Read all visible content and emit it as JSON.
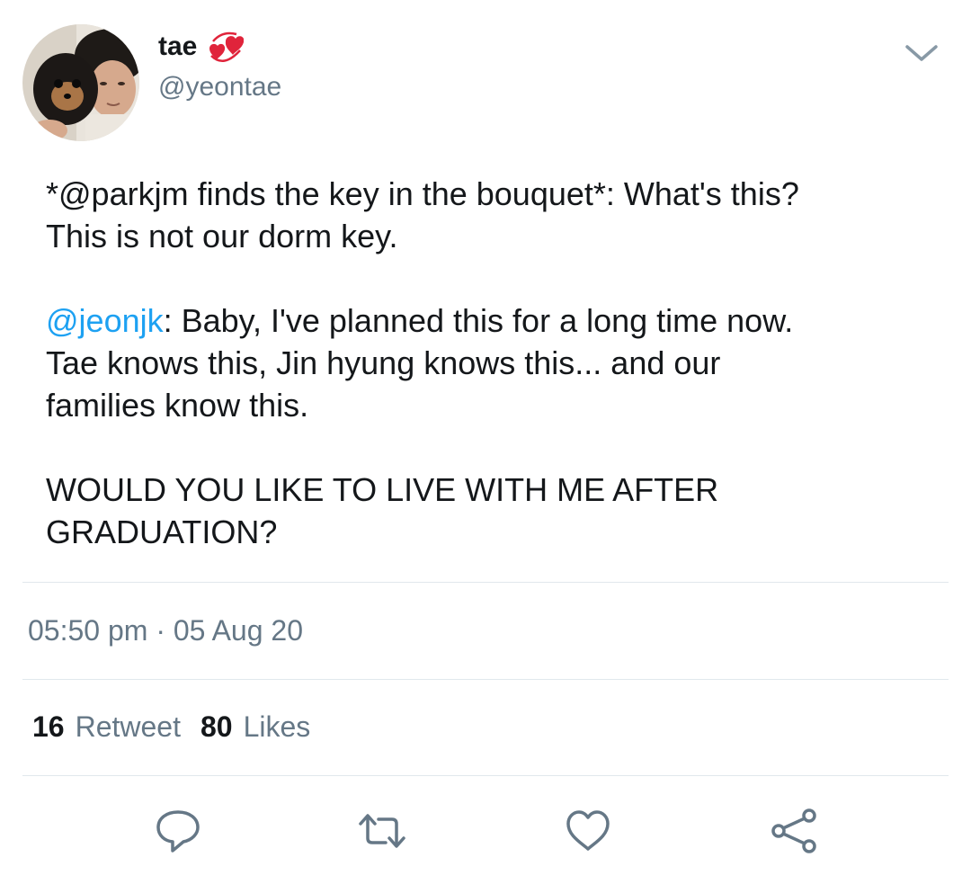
{
  "tweet": {
    "display_name": "tae",
    "name_emoji": "revolving-hearts",
    "handle": "@yeontae",
    "text": {
      "line1_prefix": "*@parkjm finds the key in the bouquet*: What's this?",
      "line2": "This is not our dorm key.",
      "mention2": "@jeonjk",
      "mention2_rest": ": Baby, I've planned this for a long time now.",
      "line4": "Tae knows this, Jin hyung knows this... and our",
      "line5": "families know this.",
      "line6": "WOULD YOU LIKE TO LIVE WITH ME AFTER",
      "line7": "GRADUATION?"
    },
    "timestamp": "05:50 pm · 05 Aug 20",
    "stats": {
      "retweet_count": "16",
      "retweet_label": "Retweet",
      "likes_count": "80",
      "likes_label": "Likes"
    },
    "actions": [
      "reply-icon",
      "retweet-icon",
      "like-icon",
      "share-icon"
    ]
  },
  "colors": {
    "text": "#14171a",
    "secondary": "#657786",
    "link": "#1da1f2",
    "divider": "#e1e8ed"
  }
}
